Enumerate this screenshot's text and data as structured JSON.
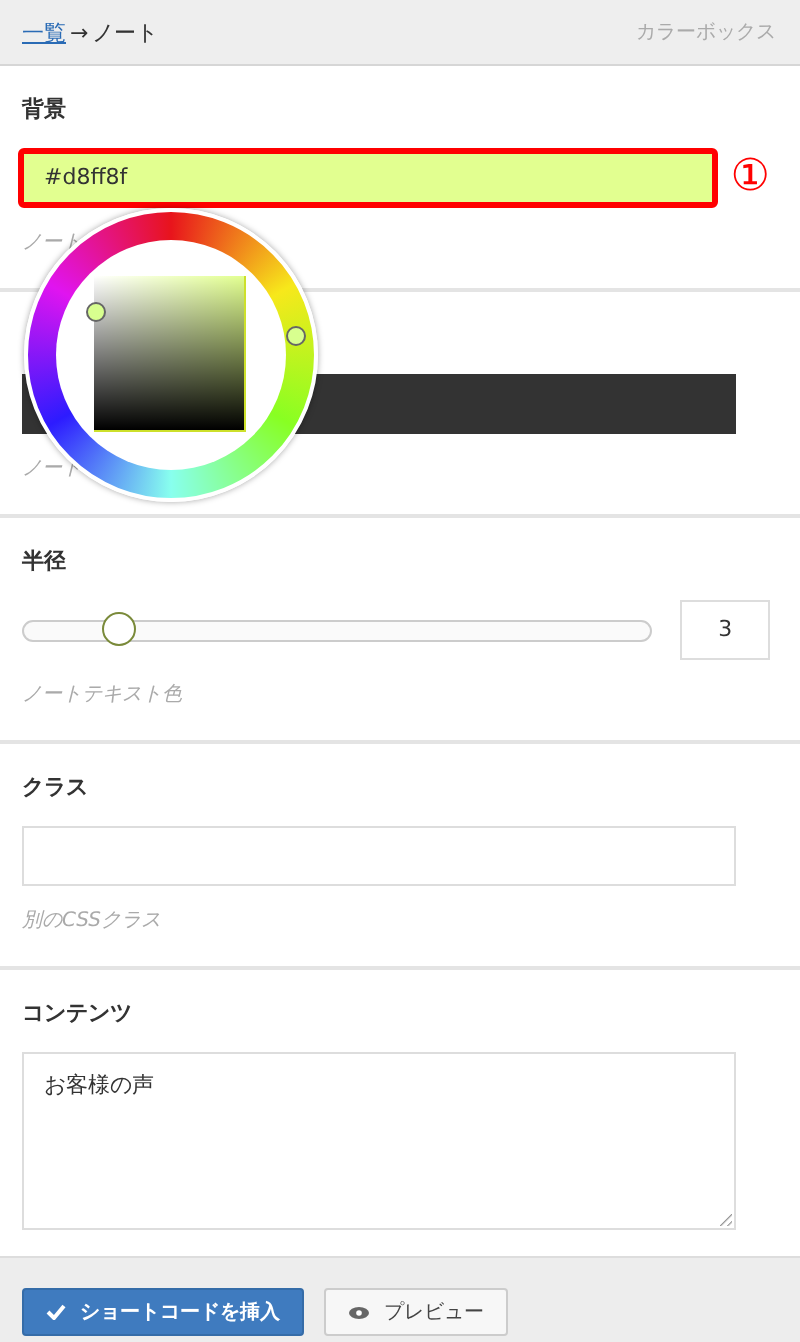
{
  "breadcrumb": {
    "link": "一覧",
    "arrow": "→",
    "current": "ノート"
  },
  "title": "カラーボックス",
  "sections": [
    {
      "kind": "color",
      "label": "背景",
      "value": "#d8ff8f",
      "color": "#e2ff90",
      "highlighted": true,
      "callout": "①",
      "picker_open": true,
      "hint": "ノート"
    },
    {
      "kind": "color",
      "color": "#333333",
      "highlighted": false,
      "picker_open": false,
      "hint": "ノート"
    },
    {
      "kind": "slider",
      "label": "半径",
      "level": 0.15,
      "value": "3",
      "hint": "ノートテキスト色"
    },
    {
      "kind": "text",
      "label": "クラス",
      "hint": "別のCSSクラス"
    },
    {
      "kind": "textarea",
      "label": "コンテンツ",
      "value": "お客様の声"
    }
  ],
  "buttons": [
    {
      "kind": "primary",
      "label": "ショートコードを挿入"
    },
    {
      "kind": "secondary",
      "label": "プレビュー"
    }
  ]
}
